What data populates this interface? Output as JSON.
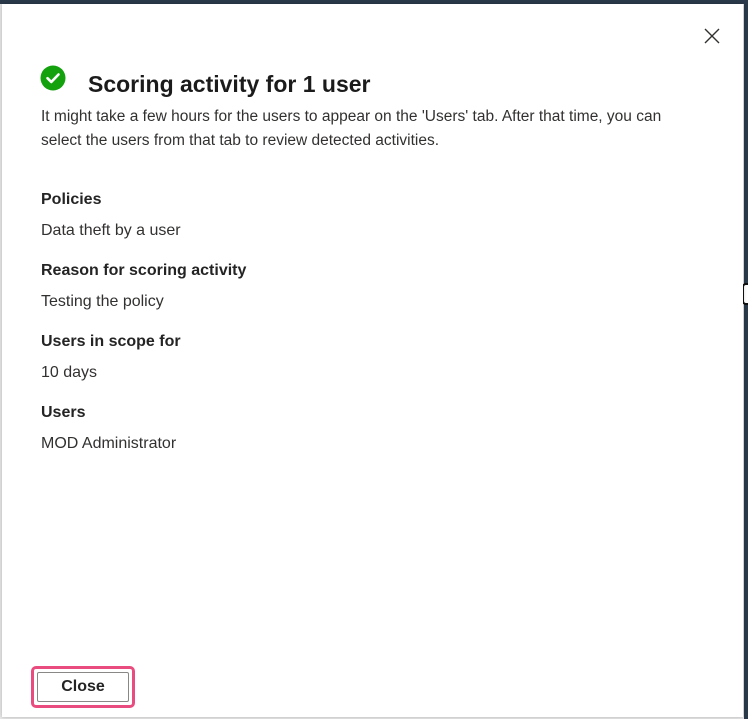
{
  "dialog": {
    "title": "Scoring activity for 1 user",
    "description": "It might take a few hours for the users to appear on the 'Users' tab. After that time, you can select the users from that tab to review detected activities.",
    "fields": [
      {
        "label": "Policies",
        "value": "Data theft by a user"
      },
      {
        "label": "Reason for scoring activity",
        "value": "Testing the policy"
      },
      {
        "label": "Users in scope for",
        "value": "10 days"
      },
      {
        "label": "Users",
        "value": "MOD Administrator"
      }
    ],
    "close_button_label": "Close"
  },
  "icons": {
    "success": "check-circle-icon",
    "dismiss": "close-icon"
  },
  "colors": {
    "success_green": "#13a10e",
    "highlight_border": "#e94c7e"
  }
}
